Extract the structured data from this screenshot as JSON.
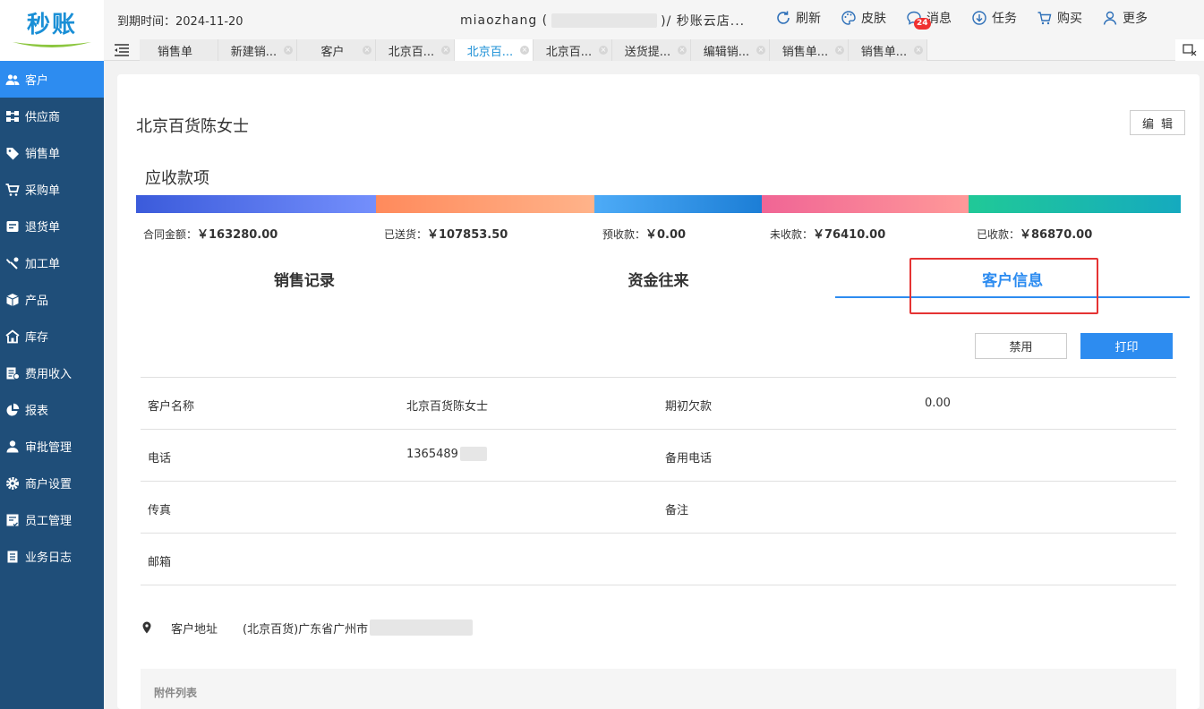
{
  "brand": {
    "logo_text": "秒账",
    "accent": "#2d8cf0",
    "sidebar_bg": "#1f4e79"
  },
  "header": {
    "expiry_label": "到期时间：2024-11-20",
    "account_user": "miaozhang (",
    "account_store": ")/ 秒账云店...",
    "toolbar": [
      {
        "label": "刷新",
        "icon": "refresh-icon"
      },
      {
        "label": "皮肤",
        "icon": "palette-icon"
      },
      {
        "label": "消息",
        "icon": "message-icon",
        "badge": "24"
      },
      {
        "label": "任务",
        "icon": "download-icon"
      },
      {
        "label": "购买",
        "icon": "cart-icon"
      },
      {
        "label": "更多",
        "icon": "user-icon"
      }
    ]
  },
  "tabs": [
    {
      "label": "销售单",
      "closable": false
    },
    {
      "label": "新建销...",
      "closable": true
    },
    {
      "label": "客户",
      "closable": true
    },
    {
      "label": "北京百...",
      "closable": true
    },
    {
      "label": "北京百...",
      "closable": true,
      "active": true
    },
    {
      "label": "北京百...",
      "closable": true
    },
    {
      "label": "送货提...",
      "closable": true
    },
    {
      "label": "编辑销...",
      "closable": true
    },
    {
      "label": "销售单...",
      "closable": true
    },
    {
      "label": "销售单...",
      "closable": true
    }
  ],
  "sidebar": {
    "items": [
      {
        "label": "客户",
        "icon": "customers-icon",
        "active": true
      },
      {
        "label": "供应商",
        "icon": "supplier-icon"
      },
      {
        "label": "销售单",
        "icon": "tag-icon"
      },
      {
        "label": "采购单",
        "icon": "cart-icon"
      },
      {
        "label": "退货单",
        "icon": "return-icon"
      },
      {
        "label": "加工单",
        "icon": "process-icon"
      },
      {
        "label": "产品",
        "icon": "box-icon"
      },
      {
        "label": "库存",
        "icon": "warehouse-icon"
      },
      {
        "label": "费用收入",
        "icon": "expense-icon"
      },
      {
        "label": "报表",
        "icon": "pie-chart-icon"
      },
      {
        "label": "审批管理",
        "icon": "approval-icon"
      },
      {
        "label": "商户设置",
        "icon": "gear-icon"
      },
      {
        "label": "员工管理",
        "icon": "staff-icon"
      },
      {
        "label": "业务日志",
        "icon": "log-icon"
      }
    ]
  },
  "main": {
    "customer_name": "北京百货陈女士",
    "edit_label": "编辑",
    "receivables_title": "应收款项",
    "receivables": [
      {
        "label": "合同金额：",
        "value": "￥163280.00",
        "color_from": "#3b5bdb",
        "color_to": "#748ffc",
        "share": 0.23
      },
      {
        "label": "已送货：",
        "value": "￥107853.50",
        "color_from": "#ff8a5c",
        "color_to": "#ffb38a",
        "share": 0.209
      },
      {
        "label": "预收款：",
        "value": "￥0.00",
        "color_from": "#4dabf7",
        "color_to": "#1c7ed6",
        "share": 0.16
      },
      {
        "label": "未收款：",
        "value": "￥76410.00",
        "color_from": "#f06595",
        "color_to": "#ff9999",
        "share": 0.198
      },
      {
        "label": "已收款：",
        "value": "￥86870.00",
        "color_from": "#20c997",
        "color_to": "#15aabf",
        "share": 0.203
      }
    ],
    "subtabs": [
      {
        "label": "销售记录"
      },
      {
        "label": "资金往来"
      },
      {
        "label": "客户信息",
        "active": true
      }
    ],
    "disable_label": "禁用",
    "print_label": "打印",
    "info_rows": [
      {
        "k1": "客户名称",
        "v1": "北京百货陈女士",
        "k2": "期初欠款",
        "v2": "0.00"
      },
      {
        "k1": "电话",
        "v1": "1365489",
        "k2": "备用电话",
        "v2": ""
      },
      {
        "k1": "传真",
        "v1": "",
        "k2": "备注",
        "v2": ""
      },
      {
        "k1": "邮箱",
        "v1": "",
        "k2": "",
        "v2": ""
      }
    ],
    "address_label": "客户地址",
    "address_value": "(北京百货)广东省广州市",
    "attachments_label": "附件列表"
  }
}
